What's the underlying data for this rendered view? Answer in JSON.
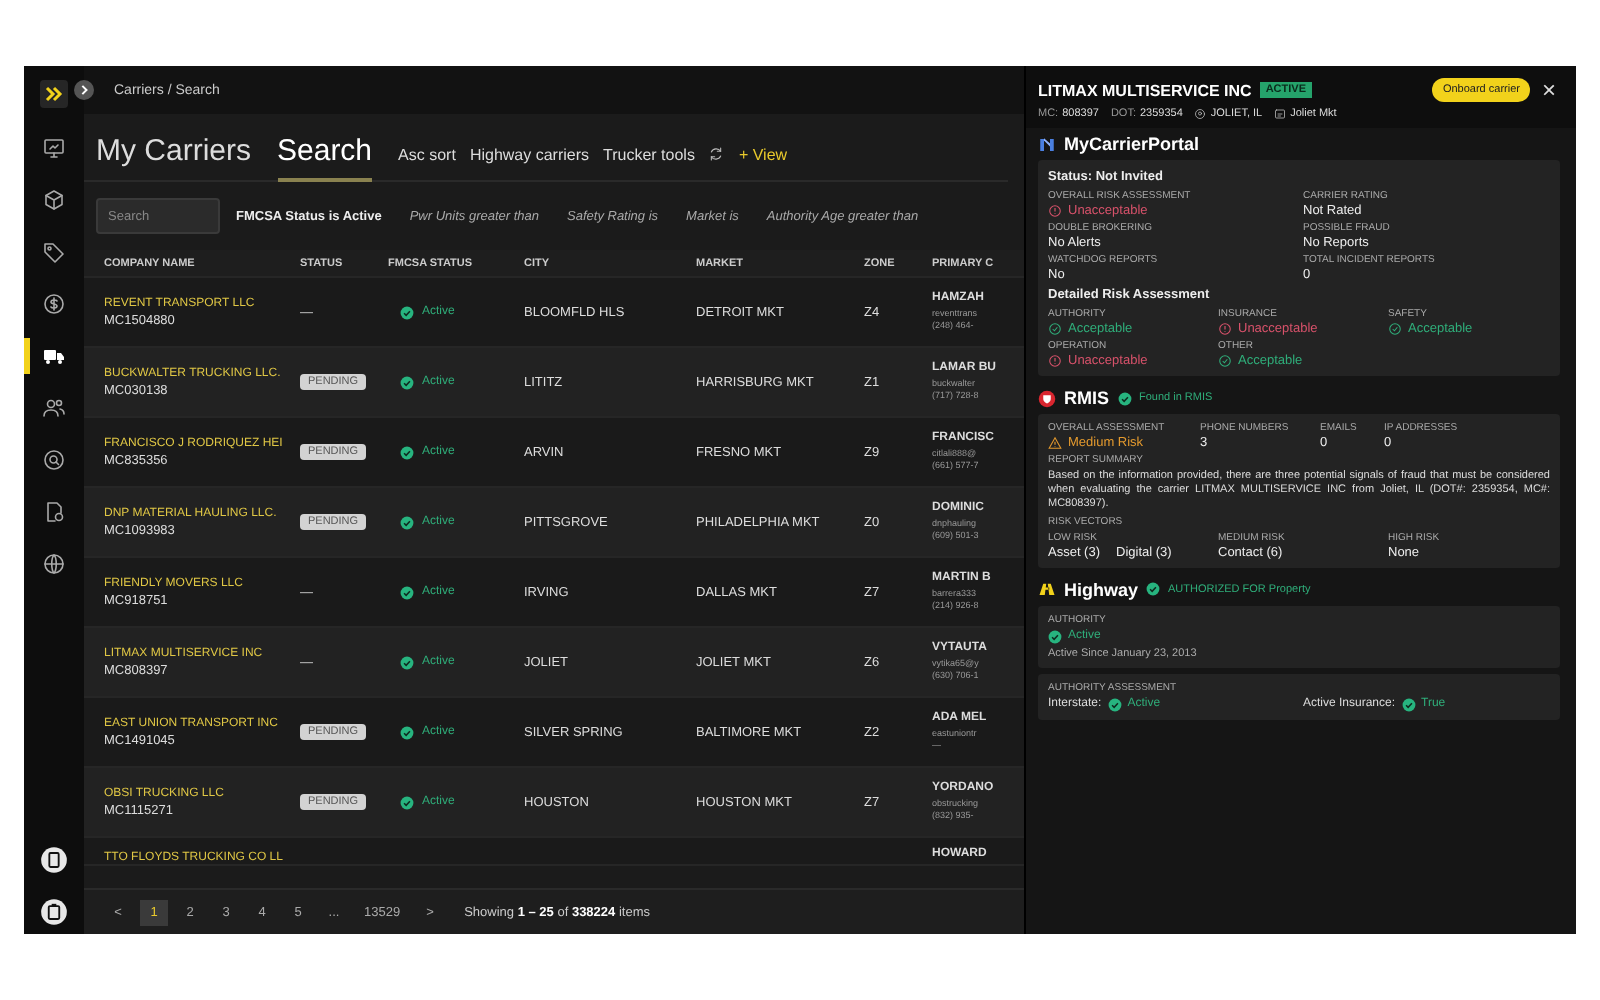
{
  "sidebar": {
    "items": [
      {
        "selected": false
      },
      {
        "selected": false
      },
      {
        "selected": false
      },
      {
        "selected": false
      },
      {
        "selected": true
      },
      {
        "selected": false
      },
      {
        "selected": false
      },
      {
        "selected": false
      },
      {
        "selected": false
      }
    ]
  },
  "breadcrumb": "Carriers / Search",
  "page_tabs": [
    {
      "label": "My Carriers",
      "selected": false
    },
    {
      "label": "Search",
      "selected": true
    }
  ],
  "view_tabs": [
    {
      "label": "Asc sort"
    },
    {
      "label": "Highway carriers"
    },
    {
      "label": "Trucker tools"
    }
  ],
  "add_view": "+ View",
  "search": {
    "placeholder": "Search"
  },
  "filters": [
    {
      "label": "FMCSA Status is Active",
      "active": true
    },
    {
      "label": "Pwr Units greater than",
      "active": false
    },
    {
      "label": "Safety Rating is",
      "active": false
    },
    {
      "label": "Market is",
      "active": false
    },
    {
      "label": "Authority Age greater than",
      "active": false
    }
  ],
  "table": {
    "columns": [
      "COMPANY NAME",
      "STATUS",
      "FMCSA STATUS",
      "CITY",
      "MARKET",
      "ZONE",
      "PRIMARY C"
    ],
    "rows": [
      {
        "company": "REVENT TRANSPORT LLC",
        "mc": "MC1504880",
        "status": {
          "kind": "dash",
          "text": "—"
        },
        "fmcsa": "Active",
        "city": "BLOOMFLD HLS",
        "market": "DETROIT MKT",
        "zone": "Z4",
        "contact": [
          "HAMZAH",
          "reventtrans",
          "(248) 464-"
        ]
      },
      {
        "company": "BUCKWALTER TRUCKING LLC.",
        "mc": "MC030138",
        "status": {
          "kind": "badge",
          "text": "PENDING"
        },
        "fmcsa": "Active",
        "city": "LITITZ",
        "market": "HARRISBURG MKT",
        "zone": "Z1",
        "contact": [
          "LAMAR BU",
          "buckwalter",
          "(717) 728-8"
        ]
      },
      {
        "company": "FRANCISCO J RODRIQUEZ HEI",
        "mc": "MC835356",
        "status": {
          "kind": "badge",
          "text": "PENDING"
        },
        "fmcsa": "Active",
        "city": "ARVIN",
        "market": "FRESNO MKT",
        "zone": "Z9",
        "contact": [
          "FRANCISC",
          "citlali888@",
          "(661) 577-7"
        ]
      },
      {
        "company": "DNP MATERIAL HAULING LLC.",
        "mc": "MC1093983",
        "status": {
          "kind": "badge",
          "text": "PENDING"
        },
        "fmcsa": "Active",
        "city": "PITTSGROVE",
        "market": "PHILADELPHIA MKT",
        "zone": "Z0",
        "contact": [
          "DOMINIC",
          "dnphauling",
          "(609) 501-3"
        ]
      },
      {
        "company": "FRIENDLY MOVERS LLC",
        "mc": "MC918751",
        "status": {
          "kind": "dash",
          "text": "—"
        },
        "fmcsa": "Active",
        "city": "IRVING",
        "market": "DALLAS MKT",
        "zone": "Z7",
        "contact": [
          "MARTIN B",
          "barrera333",
          "(214) 926-8"
        ]
      },
      {
        "company": "LITMAX MULTISERVICE INC",
        "mc": "MC808397",
        "status": {
          "kind": "dash",
          "text": "—"
        },
        "fmcsa": "Active",
        "city": "JOLIET",
        "market": "JOLIET MKT",
        "zone": "Z6",
        "contact": [
          "VYTAUTA",
          "vytika65@y",
          "(630) 706-1"
        ]
      },
      {
        "company": "EAST UNION TRANSPORT INC",
        "mc": "MC1491045",
        "status": {
          "kind": "badge",
          "text": "PENDING"
        },
        "fmcsa": "Active",
        "city": "SILVER SPRING",
        "market": "BALTIMORE MKT",
        "zone": "Z2",
        "contact": [
          "ADA MEL",
          "eastuniontr",
          "—"
        ]
      },
      {
        "company": "OBSI TRUCKING LLC",
        "mc": "MC1115271",
        "status": {
          "kind": "badge",
          "text": "PENDING"
        },
        "fmcsa": "Active",
        "city": "HOUSTON",
        "market": "HOUSTON MKT",
        "zone": "Z7",
        "contact": [
          "YORDANO",
          "obstrucking",
          "(832) 935-"
        ]
      },
      {
        "company": "TTO FLOYDS TRUCKING CO LL",
        "contact": [
          "HOWARD"
        ]
      }
    ]
  },
  "pagination": {
    "prev": "<",
    "pages": [
      {
        "label": "1",
        "selected": true
      },
      {
        "label": "2",
        "selected": false
      },
      {
        "label": "3",
        "selected": false
      },
      {
        "label": "4",
        "selected": false
      },
      {
        "label": "5",
        "selected": false
      },
      {
        "label": "...",
        "selected": false
      },
      {
        "label": "13529",
        "selected": false
      }
    ],
    "next": ">",
    "summary": "Showing **1 – 25** of **338224** items"
  },
  "detail": {
    "title": "LITMAX MULTISERVICE INC",
    "badge": "ACTIVE",
    "onboard_button": "Onboard carrier",
    "close": "×",
    "meta": [
      {
        "kind": "pair",
        "label": "MC:",
        "value": "808397"
      },
      {
        "kind": "pair",
        "label": "DOT:",
        "value": "2359354"
      },
      {
        "kind": "location",
        "value": "JOLIET, IL"
      },
      {
        "kind": "market",
        "value": "Joliet Mkt"
      }
    ],
    "sections": [
      {
        "kind": "mcp",
        "title": "MyCarrierPortal",
        "cards": [
          {
            "blocks": [
              {
                "kind": "heading",
                "text": "Status: Not Invited"
              },
              {
                "kind": "grid",
                "fields": [
                  {
                    "label": "OVERALL RISK ASSESSMENT",
                    "values": [
                      {
                        "text": "Unacceptable",
                        "kind": "bad"
                      }
                    ]
                  },
                  {
                    "label": "CARRIER RATING",
                    "values": [
                      {
                        "text": "Not Rated",
                        "kind": "plain"
                      }
                    ]
                  },
                  {
                    "label": "DOUBLE BROKERING",
                    "values": [
                      {
                        "text": "No Alerts",
                        "kind": "plain"
                      }
                    ]
                  },
                  {
                    "label": "POSSIBLE FRAUD",
                    "values": [
                      {
                        "text": "No Reports",
                        "kind": "plain"
                      }
                    ]
                  },
                  {
                    "label": "WATCHDOG REPORTS",
                    "values": [
                      {
                        "text": "No",
                        "kind": "plain"
                      }
                    ]
                  },
                  {
                    "label": "TOTAL INCIDENT REPORTS",
                    "values": [
                      {
                        "text": "0",
                        "kind": "plain"
                      }
                    ]
                  }
                ]
              },
              {
                "kind": "heading",
                "text": "Detailed Risk Assessment"
              },
              {
                "kind": "grid",
                "fields": [
                  {
                    "label": "AUTHORITY",
                    "values": [
                      {
                        "text": "Acceptable",
                        "kind": "good"
                      }
                    ]
                  },
                  {
                    "label": "INSURANCE",
                    "values": [
                      {
                        "text": "Unacceptable",
                        "kind": "bad"
                      }
                    ]
                  },
                  {
                    "label": "SAFETY",
                    "values": [
                      {
                        "text": "Acceptable",
                        "kind": "good"
                      }
                    ]
                  },
                  {
                    "label": "OPERATION",
                    "values": [
                      {
                        "text": "Unacceptable",
                        "kind": "bad"
                      }
                    ]
                  },
                  {
                    "label": "OTHER",
                    "values": [
                      {
                        "text": "Acceptable",
                        "kind": "good"
                      }
                    ]
                  }
                ]
              }
            ]
          }
        ]
      },
      {
        "kind": "rmis",
        "title": "RMIS",
        "status": "Found in RMIS",
        "cards": [
          {
            "blocks": [
              {
                "kind": "grid",
                "fields": [
                  {
                    "label": "OVERALL ASSESSMENT",
                    "values": [
                      {
                        "text": "Medium Risk",
                        "kind": "warn"
                      }
                    ]
                  },
                  {
                    "label": "PHONE NUMBERS",
                    "values": [
                      {
                        "text": "3",
                        "kind": "plain"
                      }
                    ]
                  },
                  {
                    "label": "EMAILS",
                    "values": [
                      {
                        "text": "0",
                        "kind": "plain"
                      }
                    ]
                  },
                  {
                    "label": "IP ADDRESSES",
                    "values": [
                      {
                        "text": "0",
                        "kind": "plain"
                      }
                    ]
                  }
                ]
              },
              {
                "kind": "label",
                "text": "REPORT SUMMARY"
              },
              {
                "kind": "paragraph",
                "text": "Based on the information provided, there are three potential signals of fraud that must be considered when evaluating the carrier LITMAX MULTISERVICE INC from Joliet, IL (DOT#: 2359354, MC#: MC808397)."
              },
              {
                "kind": "label",
                "text": "RISK VECTORS"
              },
              {
                "kind": "grid",
                "fields": [
                  {
                    "label": "LOW RISK",
                    "values": [
                      {
                        "text": "Asset (3)",
                        "kind": "plain"
                      },
                      {
                        "text": "Digital (3)",
                        "kind": "plain"
                      }
                    ]
                  },
                  {
                    "label": "MEDIUM RISK",
                    "values": [
                      {
                        "text": "Contact (6)",
                        "kind": "plain"
                      }
                    ]
                  },
                  {
                    "label": "HIGH RISK",
                    "values": [
                      {
                        "text": "None",
                        "kind": "plain"
                      }
                    ]
                  }
                ]
              }
            ]
          }
        ]
      },
      {
        "kind": "highway",
        "title": "Highway",
        "status": "AUTHORIZED FOR Property",
        "cards": [
          {
            "blocks": [
              {
                "kind": "label",
                "text": "AUTHORITY"
              },
              {
                "kind": "grid",
                "fields": [
                  {
                    "values": [
                      {
                        "text": "Active",
                        "kind": "check"
                      }
                    ]
                  }
                ]
              },
              {
                "kind": "note",
                "text": "Active Since January 23, 2013"
              }
            ]
          },
          {
            "blocks": [
              {
                "kind": "label",
                "text": "AUTHORITY ASSESSMENT"
              },
              {
                "kind": "grid",
                "fields": [
                  {
                    "inline": "Interstate:",
                    "values": [
                      {
                        "text": "Active",
                        "kind": "check"
                      }
                    ]
                  },
                  {
                    "inline": "Active Insurance:",
                    "values": [
                      {
                        "text": "True",
                        "kind": "check"
                      }
                    ]
                  }
                ]
              }
            ]
          }
        ]
      }
    ]
  }
}
